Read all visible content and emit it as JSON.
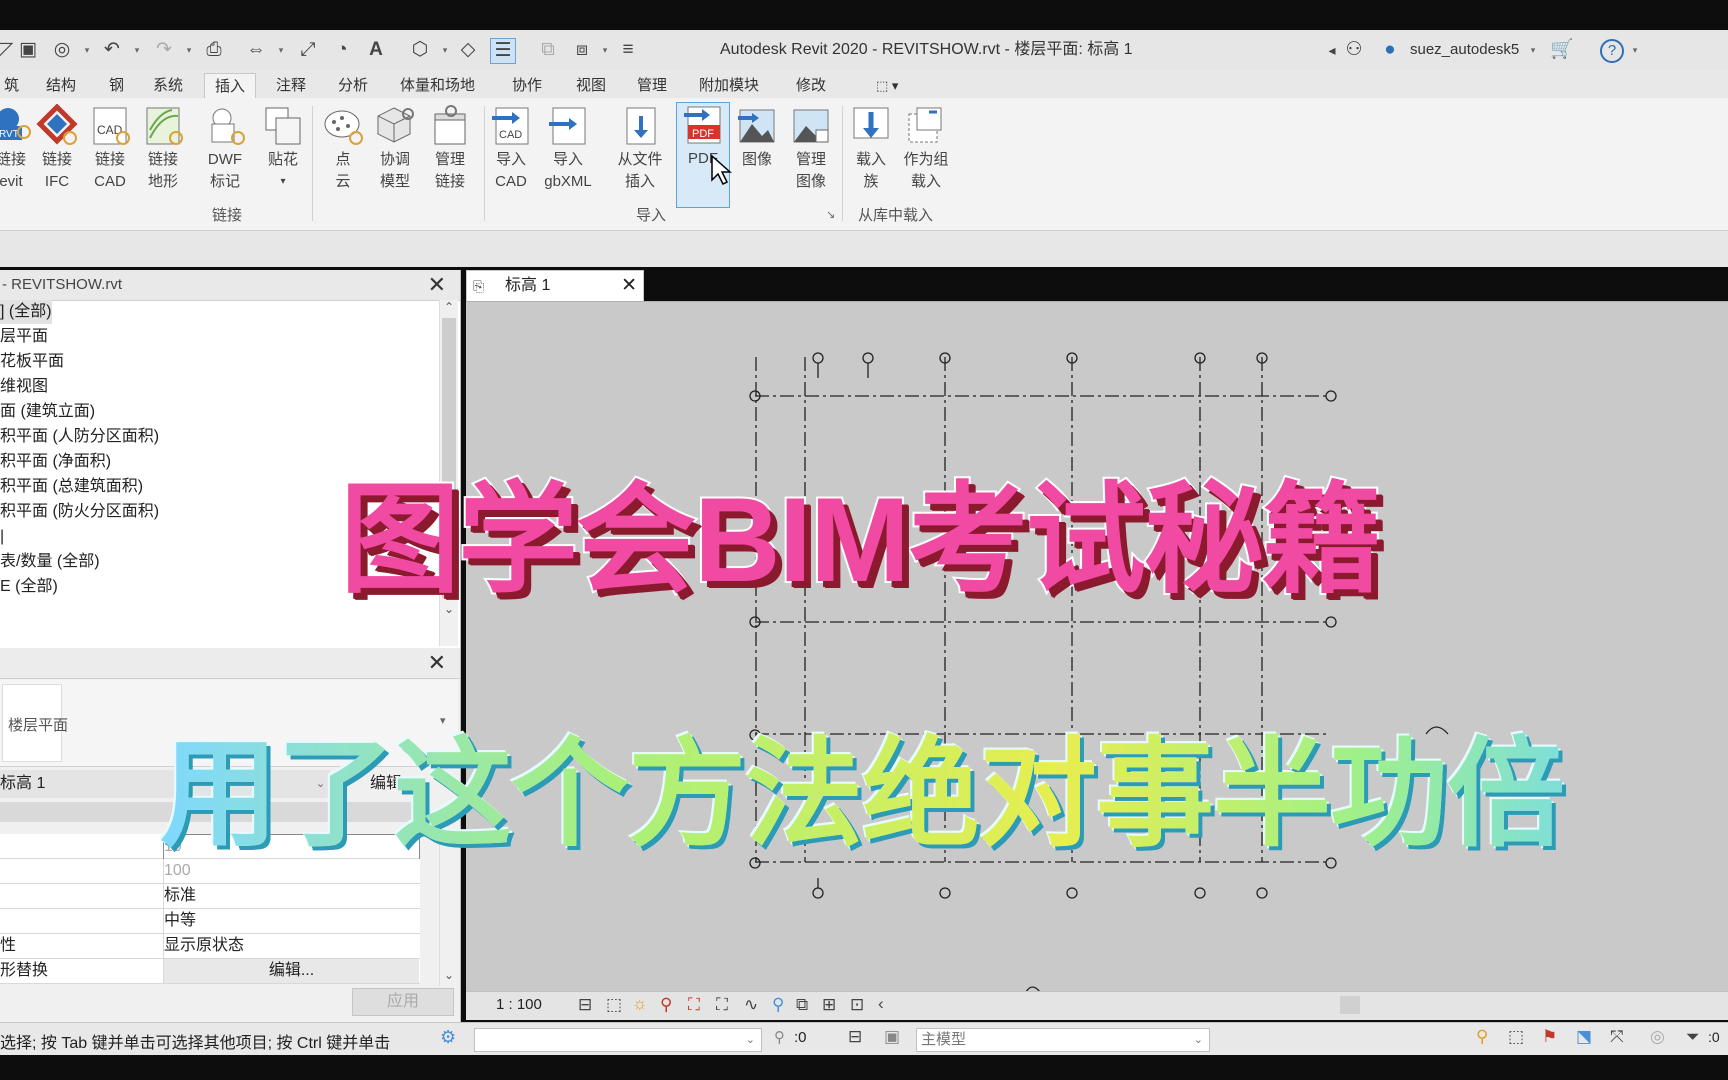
{
  "window": {
    "title": "Autodesk Revit 2020 - REVITSHOW.rvt - 楼层平面: 标高 1",
    "user": "suez_autodesk5"
  },
  "menu_tabs": [
    "筑",
    "结构",
    "钢",
    "系统",
    "插入",
    "注释",
    "分析",
    "体量和场地",
    "协作",
    "视图",
    "管理",
    "附加模块",
    "修改"
  ],
  "active_tab": "插入",
  "ribbon": {
    "buttons": [
      {
        "line1": "链接",
        "line2": "evit",
        "icon": "revit-link-icon"
      },
      {
        "line1": "链接",
        "line2": "IFC",
        "icon": "ifc-link-icon"
      },
      {
        "line1": "链接",
        "line2": "CAD",
        "icon": "cad-link-icon"
      },
      {
        "line1": "链接",
        "line2": "地形",
        "icon": "topography-link-icon"
      },
      {
        "line1": "DWF",
        "line2": "标记",
        "icon": "dwf-markup-icon"
      },
      {
        "line1": "贴花",
        "line2": "▾",
        "icon": "decal-icon"
      },
      {
        "line1": "点",
        "line2": "云",
        "icon": "point-cloud-icon"
      },
      {
        "line1": "协调",
        "line2": "模型",
        "icon": "coordination-model-icon"
      },
      {
        "line1": "管理",
        "line2": "链接",
        "icon": "manage-links-icon"
      },
      {
        "line1": "导入",
        "line2": "CAD",
        "icon": "import-cad-icon"
      },
      {
        "line1": "导入",
        "line2": "gbXML",
        "icon": "import-gbxml-icon"
      },
      {
        "line1": "从文件",
        "line2": "插入",
        "icon": "insert-from-file-icon"
      },
      {
        "line1": "PDF",
        "line2": "",
        "icon": "pdf-icon"
      },
      {
        "line1": "图像",
        "line2": "",
        "icon": "image-icon"
      },
      {
        "line1": "管理",
        "line2": "图像",
        "icon": "manage-images-icon"
      },
      {
        "line1": "载入",
        "line2": "族",
        "icon": "load-family-icon"
      },
      {
        "line1": "作为组",
        "line2": "载入",
        "icon": "load-as-group-icon"
      }
    ],
    "groups": {
      "link": "链接",
      "import": "导入",
      "library": "从库中载入"
    },
    "badge_cad": "CAD",
    "badge_pdf": "PDF",
    "badge_rvt": "RVT"
  },
  "project_browser": {
    "title": "- REVITSHOW.rvt",
    "items": [
      "] (全部)",
      "层平面",
      "花板平面",
      "维视图",
      "面 (建筑立面)",
      "积平面 (人防分区面积)",
      "积平面 (净面积)",
      "积平面 (总建筑面积)",
      "积平面 (防火分区面积)",
      "|",
      "表/数量 (全部)",
      "E (全部)"
    ]
  },
  "properties": {
    "type_label": "楼层平面",
    "instance": "标高 1",
    "edit_type": "编辑",
    "rows": [
      {
        "name": "",
        "value": "10"
      },
      {
        "name": "",
        "value": "100"
      },
      {
        "name": "",
        "value": "标准"
      },
      {
        "name": "",
        "value": "中等"
      },
      {
        "name": "性",
        "value": "显示原状态"
      },
      {
        "name": "形替换",
        "value": "编辑..."
      }
    ],
    "apply": "应用"
  },
  "view_tab": {
    "label": "标高 1"
  },
  "view_bar": {
    "scale": "1 : 100"
  },
  "status": {
    "hint": "选择; 按 Tab 键并单击可选择其他项目; 按 Ctrl 键并单击",
    "count": ":0",
    "model": "主模型",
    "filter_count": ":0"
  },
  "overlay": {
    "headline": "图学会BIM考试秘籍",
    "subline": "用了这个方法绝对事半功倍"
  },
  "colors": {
    "headline": "#f14aa2",
    "headline_shadow": "#8b1a2e",
    "subline_outline": "#2b9bb6",
    "active_button": "#d8e9f8",
    "canvas": "#c9c9c9"
  }
}
